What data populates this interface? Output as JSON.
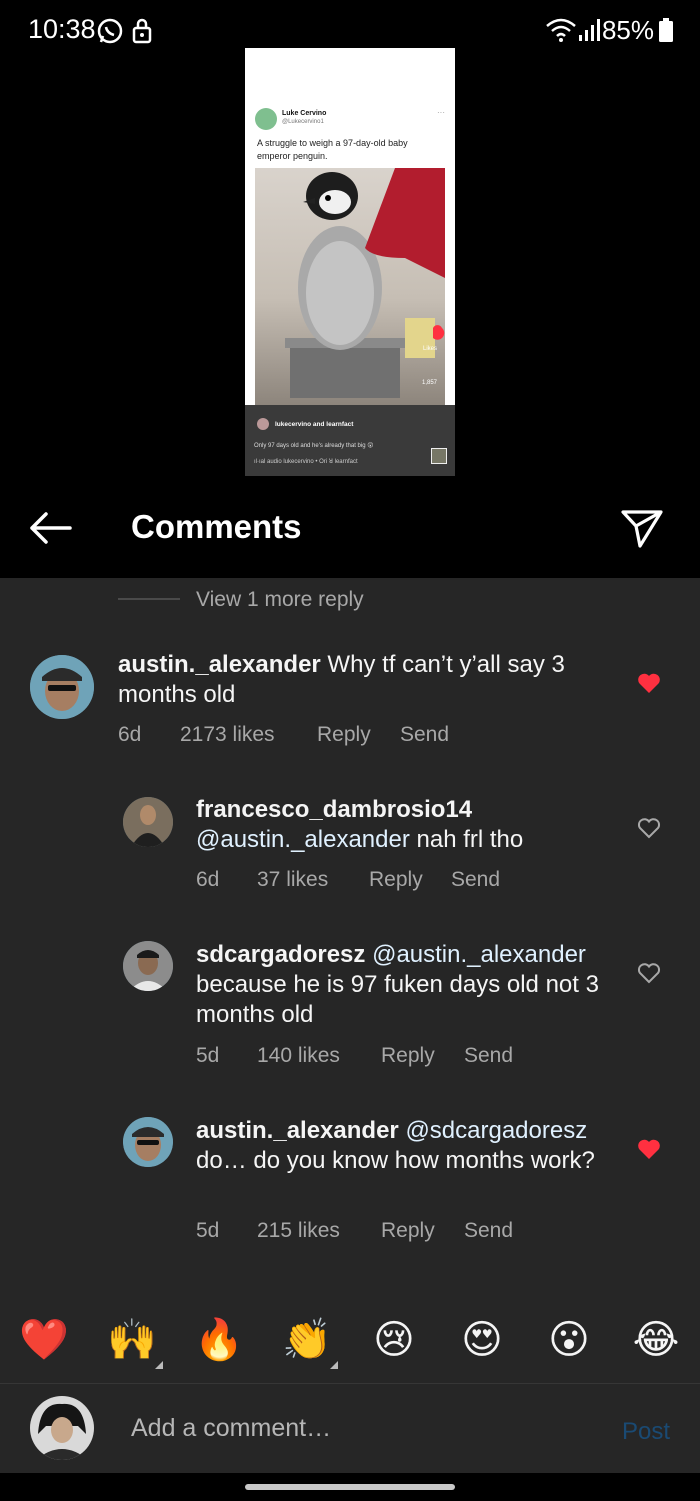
{
  "status_bar": {
    "time": "10:38",
    "battery": "85%",
    "icons": [
      "whatsapp-icon",
      "lock-icon",
      "wifi-icon",
      "signal-icon",
      "battery-icon"
    ]
  },
  "preview": {
    "tweet_name": "Luke Cervino",
    "tweet_handle": "@Lukecervino1",
    "tweet_text": "A struggle to weigh a 97-day-old baby emperor penguin.",
    "reel_user": "lukecervino and learnfact",
    "reel_caption": "Only 97 days old and he's already that big 😲",
    "reel_audio": "ıl·ıal audio   lukecervino • Ori   ꓤ learnfact",
    "likes_label": "Likes",
    "comment_count": "1,857"
  },
  "header": {
    "title": "Comments"
  },
  "view_more": "View 1 more reply",
  "comments": [
    {
      "user": "austin._alexander",
      "mention": "",
      "text": " Why tf can’t y’all say 3 months old",
      "age": "6d",
      "likes": "2173 likes",
      "reply": "Reply",
      "send": "Send",
      "liked": true
    },
    {
      "user": "francesco_dambrosio14",
      "mention": "@austin._alexander",
      "text": " nah frl tho",
      "age": "6d",
      "likes": "37 likes",
      "reply": "Reply",
      "send": "Send",
      "liked": false
    },
    {
      "user": "sdcargadoresz",
      "mention": "@austin._alexander",
      "text": " because he is 97 fuken days old not 3 months old",
      "age": "5d",
      "likes": "140 likes",
      "reply": "Reply",
      "send": "Send",
      "liked": false
    },
    {
      "user": "austin._alexander",
      "mention": "@sdcargadoresz",
      "text": " do… do you know how months work?",
      "age": "5d",
      "likes": "215 likes",
      "reply": "Reply",
      "send": "Send",
      "liked": true
    }
  ],
  "emoji_bar": [
    "❤️",
    "🙌",
    "🔥",
    "👏",
    "😢",
    "😍",
    "😮",
    "😂"
  ],
  "composer": {
    "placeholder": "Add a comment…",
    "post": "Post"
  },
  "colors": {
    "background": "#262626",
    "liked_heart": "#ff3040",
    "post_disabled": "#1a4a73"
  }
}
